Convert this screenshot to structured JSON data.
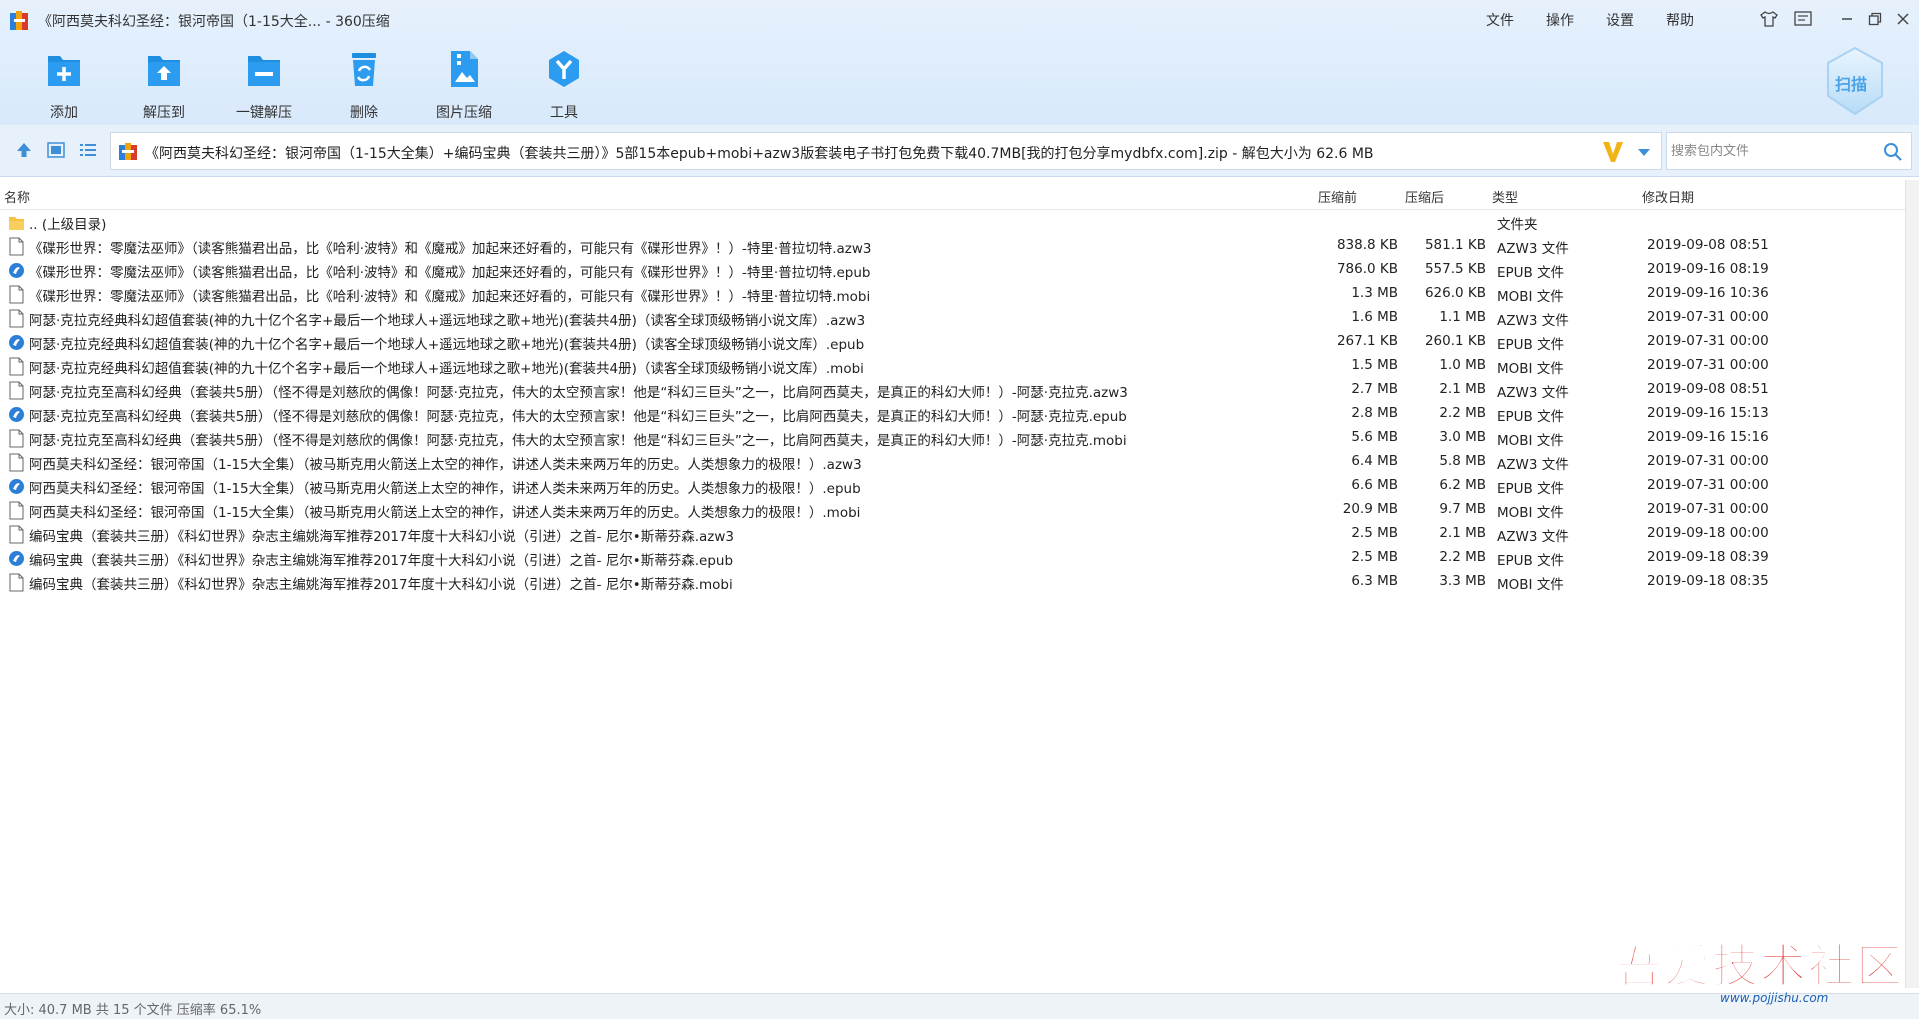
{
  "window": {
    "title": "《阿西莫夫科幻圣经：银河帝国（1-15大全... - 360压缩",
    "menu": [
      "文件",
      "操作",
      "设置",
      "帮助"
    ]
  },
  "toolbar": {
    "items": [
      {
        "label": "添加",
        "icon": "add-file-icon"
      },
      {
        "label": "解压到",
        "icon": "extract-to-icon"
      },
      {
        "label": "一键解压",
        "icon": "one-click-extract-icon"
      },
      {
        "label": "删除",
        "icon": "delete-icon"
      },
      {
        "label": "图片压缩",
        "icon": "image-compress-icon"
      },
      {
        "label": "工具",
        "icon": "tools-icon"
      }
    ],
    "scan_label": "扫描"
  },
  "address": {
    "path": "《阿西莫夫科幻圣经：银河帝国（1-15大全集）+编码宝典（套装共三册）》5部15本epub+mobi+azw3版套装电子书打包免费下载40.7MB[我的打包分享mydbfx.com].zip - 解包大小为 62.6 MB",
    "search_placeholder": "搜索包内文件"
  },
  "columns": {
    "name": "名称",
    "packed": "压缩前",
    "size": "压缩后",
    "type": "类型",
    "modified": "修改日期"
  },
  "files": [
    {
      "name": ".. (上级目录)",
      "packed": "",
      "size": "",
      "type": "文件夹",
      "date": "",
      "icon": "folder"
    },
    {
      "name": "《碟形世界：零魔法巫师》（读客熊猫君出品，比《哈利·波特》和《魔戒》加起来还好看的，可能只有《碟形世界》！）-特里·普拉切特.azw3",
      "packed": "838.8 KB",
      "size": "581.1 KB",
      "type": "AZW3 文件",
      "date": "2019-09-08 08:51",
      "icon": "doc"
    },
    {
      "name": "《碟形世界：零魔法巫师》（读客熊猫君出品，比《哈利·波特》和《魔戒》加起来还好看的，可能只有《碟形世界》！）-特里·普拉切特.epub",
      "packed": "786.0 KB",
      "size": "557.5 KB",
      "type": "EPUB 文件",
      "date": "2019-09-16 08:19",
      "icon": "epub"
    },
    {
      "name": "《碟形世界：零魔法巫师》（读客熊猫君出品，比《哈利·波特》和《魔戒》加起来还好看的，可能只有《碟形世界》！）-特里·普拉切特.mobi",
      "packed": "1.3 MB",
      "size": "626.0 KB",
      "type": "MOBI 文件",
      "date": "2019-09-16 10:36",
      "icon": "doc"
    },
    {
      "name": "阿瑟·克拉克经典科幻超值套装(神的九十亿个名字+最后一个地球人+遥远地球之歌+地光)(套装共4册)（读客全球顶级畅销小说文库）.azw3",
      "packed": "1.6 MB",
      "size": "1.1 MB",
      "type": "AZW3 文件",
      "date": "2019-07-31 00:00",
      "icon": "doc"
    },
    {
      "name": "阿瑟·克拉克经典科幻超值套装(神的九十亿个名字+最后一个地球人+遥远地球之歌+地光)(套装共4册)（读客全球顶级畅销小说文库）.epub",
      "packed": "267.1 KB",
      "size": "260.1 KB",
      "type": "EPUB 文件",
      "date": "2019-07-31 00:00",
      "icon": "epub"
    },
    {
      "name": "阿瑟·克拉克经典科幻超值套装(神的九十亿个名字+最后一个地球人+遥远地球之歌+地光)(套装共4册)（读客全球顶级畅销小说文库）.mobi",
      "packed": "1.5 MB",
      "size": "1.0 MB",
      "type": "MOBI 文件",
      "date": "2019-07-31 00:00",
      "icon": "doc"
    },
    {
      "name": "阿瑟·克拉克至高科幻经典（套装共5册）（怪不得是刘慈欣的偶像！阿瑟·克拉克，伟大的太空预言家！他是“科幻三巨头”之一，比肩阿西莫夫，是真正的科幻大师！）-阿瑟·克拉克.azw3",
      "packed": "2.7 MB",
      "size": "2.1 MB",
      "type": "AZW3 文件",
      "date": "2019-09-08 08:51",
      "icon": "doc"
    },
    {
      "name": "阿瑟·克拉克至高科幻经典（套装共5册）（怪不得是刘慈欣的偶像！阿瑟·克拉克，伟大的太空预言家！他是“科幻三巨头”之一，比肩阿西莫夫，是真正的科幻大师！）-阿瑟·克拉克.epub",
      "packed": "2.8 MB",
      "size": "2.2 MB",
      "type": "EPUB 文件",
      "date": "2019-09-16 15:13",
      "icon": "epub"
    },
    {
      "name": "阿瑟·克拉克至高科幻经典（套装共5册）（怪不得是刘慈欣的偶像！阿瑟·克拉克，伟大的太空预言家！他是“科幻三巨头”之一，比肩阿西莫夫，是真正的科幻大师！）-阿瑟·克拉克.mobi",
      "packed": "5.6 MB",
      "size": "3.0 MB",
      "type": "MOBI 文件",
      "date": "2019-09-16 15:16",
      "icon": "doc"
    },
    {
      "name": "阿西莫夫科幻圣经：银河帝国（1-15大全集）（被马斯克用火箭送上太空的神作，讲述人类未来两万年的历史。人类想象力的极限！）.azw3",
      "packed": "6.4 MB",
      "size": "5.8 MB",
      "type": "AZW3 文件",
      "date": "2019-07-31 00:00",
      "icon": "doc"
    },
    {
      "name": "阿西莫夫科幻圣经：银河帝国（1-15大全集）（被马斯克用火箭送上太空的神作，讲述人类未来两万年的历史。人类想象力的极限！）.epub",
      "packed": "6.6 MB",
      "size": "6.2 MB",
      "type": "EPUB 文件",
      "date": "2019-07-31 00:00",
      "icon": "epub"
    },
    {
      "name": "阿西莫夫科幻圣经：银河帝国（1-15大全集）（被马斯克用火箭送上太空的神作，讲述人类未来两万年的历史。人类想象力的极限！）.mobi",
      "packed": "20.9 MB",
      "size": "9.7 MB",
      "type": "MOBI 文件",
      "date": "2019-07-31 00:00",
      "icon": "doc"
    },
    {
      "name": "编码宝典（套装共三册）《科幻世界》杂志主编姚海军推荐2017年度十大科幻小说（引进）之首- 尼尔•斯蒂芬森.azw3",
      "packed": "2.5 MB",
      "size": "2.1 MB",
      "type": "AZW3 文件",
      "date": "2019-09-18 00:00",
      "icon": "doc"
    },
    {
      "name": "编码宝典（套装共三册）《科幻世界》杂志主编姚海军推荐2017年度十大科幻小说（引进）之首- 尼尔•斯蒂芬森.epub",
      "packed": "2.5 MB",
      "size": "2.2 MB",
      "type": "EPUB 文件",
      "date": "2019-09-18 08:39",
      "icon": "epub"
    },
    {
      "name": "编码宝典（套装共三册）《科幻世界》杂志主编姚海军推荐2017年度十大科幻小说（引进）之首- 尼尔•斯蒂芬森.mobi",
      "packed": "6.3 MB",
      "size": "3.3 MB",
      "type": "MOBI 文件",
      "date": "2019-09-18 08:35",
      "icon": "doc"
    }
  ],
  "status": "大小: 40.7 MB 共 15 个文件 压缩率 65.1%",
  "watermark": {
    "text": "吾爱技术社区",
    "url": "www.pojjishu.com"
  },
  "colors": {
    "accent": "#1e8fe0",
    "toolbar_bg": "#dcebfb",
    "watermark": "#d9261c"
  }
}
